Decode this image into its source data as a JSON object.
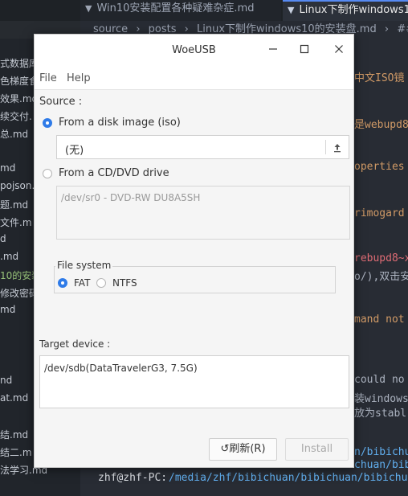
{
  "editor": {
    "tabs": [
      {
        "icon": "file-icon",
        "label": "Win10安装配置各种疑难杂症.md"
      },
      {
        "icon": "file-icon",
        "label": "Linux下制作windows1"
      }
    ],
    "breadcrumb": [
      "source",
      "posts",
      "Linux下制作windows10的安装盘.md",
      "##"
    ],
    "sidebar_items": [
      "式数据库",
      "色梯度食",
      "效果.md",
      "续交付.",
      "总.md",
      "md",
      "pojson.",
      "题.md",
      "文件.m",
      "d",
      ".md",
      "10的安装",
      "修改密码",
      "md",
      "nd",
      "at.md",
      "结.md",
      "结二.m",
      "法学习.md"
    ],
    "fragments": [
      "中文ISO镜",
      "是webupd8",
      "operties",
      "rimogard",
      "rebupd8~x",
      "o/),双击安",
      "mand not",
      "could no",
      "装windows",
      "放为stabl",
      "n/bibichu",
      "chuan/bib",
      "zhf@zhf-PC:",
      "/media/zhf/bibichuan/bibichuan/bibichu"
    ]
  },
  "dialog": {
    "title": "WoeUSB",
    "menu": [
      "File",
      "Help"
    ],
    "source_label": "Source :",
    "from_iso_label": "From a disk image (iso)",
    "iso_path": "(无)",
    "from_cd_label": "From a CD/DVD drive",
    "cd_device": "/dev/sr0 - DVD-RW DU8A5SH",
    "filesystem_label": "File system",
    "fs_options": [
      "FAT",
      "NTFS"
    ],
    "target_label": "Target device :",
    "target_device": "/dev/sdb(DataTravelerG3, 7.5G)",
    "refresh_label": "刷新(R)",
    "install_label": "Install"
  }
}
